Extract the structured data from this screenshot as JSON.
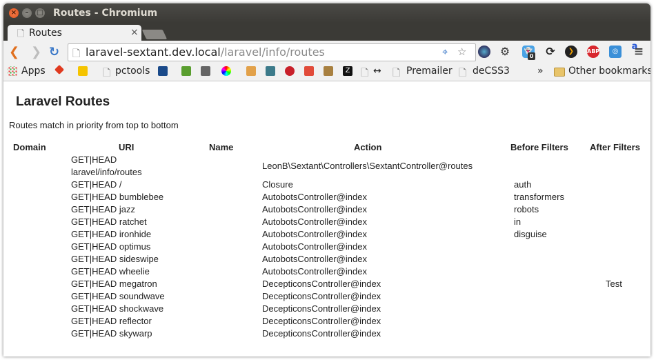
{
  "window": {
    "title": "Routes - Chromium"
  },
  "tab": {
    "title": "Routes",
    "close": "×"
  },
  "address_bar": {
    "host": "laravel-sextant.dev.local",
    "path": "/laravel/info/routes"
  },
  "bookmarks": {
    "apps": "Apps",
    "pctools": "pctools",
    "arrows": "↔",
    "premailer": "Premailer",
    "decss3": "deCSS3",
    "more": "»",
    "other": "Other bookmarks"
  },
  "extensions": {
    "badge_count": "0",
    "abp": "ABP"
  },
  "page": {
    "heading": "Laravel Routes",
    "subtitle": "Routes match in priority from top to bottom",
    "columns": [
      "Domain",
      "URI",
      "Name",
      "Action",
      "Before Filters",
      "After Filters"
    ],
    "rows": [
      {
        "uri_line1": "GET|HEAD",
        "uri_line2": "laravel/info/routes",
        "action": "LeonB\\Sextant\\Controllers\\SextantController@routes",
        "before": "",
        "after": ""
      },
      {
        "uri": "GET|HEAD /",
        "action": "Closure",
        "before": "auth",
        "after": ""
      },
      {
        "uri": "GET|HEAD bumblebee",
        "action": "AutobotsController@index",
        "before": "transformers",
        "after": ""
      },
      {
        "uri": "GET|HEAD jazz",
        "action": "AutobotsController@index",
        "before": "robots",
        "after": ""
      },
      {
        "uri": "GET|HEAD ratchet",
        "action": "AutobotsController@index",
        "before": "in",
        "after": ""
      },
      {
        "uri": "GET|HEAD ironhide",
        "action": "AutobotsController@index",
        "before": "disguise",
        "after": ""
      },
      {
        "uri": "GET|HEAD optimus",
        "action": "AutobotsController@index",
        "before": "",
        "after": ""
      },
      {
        "uri": "GET|HEAD sideswipe",
        "action": "AutobotsController@index",
        "before": "",
        "after": ""
      },
      {
        "uri": "GET|HEAD wheelie",
        "action": "AutobotsController@index",
        "before": "",
        "after": ""
      },
      {
        "uri": "GET|HEAD megatron",
        "action": "DecepticonsController@index",
        "before": "",
        "after": "Test"
      },
      {
        "uri": "GET|HEAD soundwave",
        "action": "DecepticonsController@index",
        "before": "",
        "after": ""
      },
      {
        "uri": "GET|HEAD shockwave",
        "action": "DecepticonsController@index",
        "before": "",
        "after": ""
      },
      {
        "uri": "GET|HEAD reflector",
        "action": "DecepticonsController@index",
        "before": "",
        "after": ""
      },
      {
        "uri": "GET|HEAD skywarp",
        "action": "DecepticonsController@index",
        "before": "",
        "after": ""
      }
    ]
  }
}
